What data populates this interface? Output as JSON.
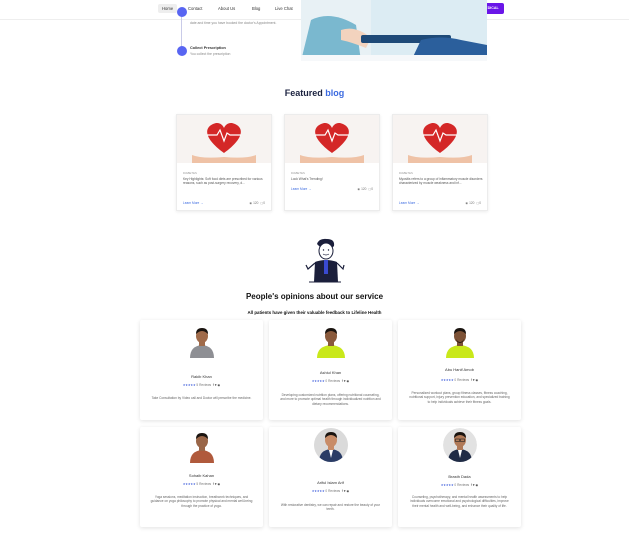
{
  "nav": {
    "items": [
      "Home",
      "Contact",
      "About Us",
      "Blog",
      "Live Chat",
      "Health Calculator",
      "Health Plans",
      "For Doctors",
      "Services"
    ],
    "cta": "EMR/MEDICAL"
  },
  "timeline": {
    "step1_text": "date and time you have booked the doctor's Appointment.",
    "step2_title": "Collect Prescription",
    "step2_text": "You collect the prescription"
  },
  "featured": {
    "title_main": "Featured",
    "title_accent": "blog",
    "posts": [
      {
        "category": "DIABETES",
        "desc": "Key Highlights: Soft food diets are prescribed for various reasons, such as post-surgery recovery, d...",
        "learn": "Learn More",
        "views": "120",
        "comments": "0"
      },
      {
        "category": "DIABETES",
        "desc": "Look What's Trending!",
        "learn": "Learn More",
        "views": "120",
        "comments": "0"
      },
      {
        "category": "DIABETES",
        "desc": "Myositis refers to a group of inflammatory muscle disorders characterized by muscle weakness and inf...",
        "learn": "Learn More",
        "views": "120",
        "comments": "0"
      }
    ]
  },
  "opinions": {
    "title": "People's opinions about our service",
    "subtitle": "All patients have given their valuable feedback to Lifeline Health",
    "reviews": [
      {
        "name": "Rakib Khan",
        "stars": "★★★★★",
        "count": "5 Reviews",
        "social": "f ♥ ◉",
        "text": "Take Consultation by Video call and Doctor will prescribe the medicine."
      },
      {
        "name": "Ashiul Khan",
        "stars": "★★★★★",
        "count": "0 Reviews",
        "social": "f ♥ ◉",
        "text": "Developing customized nutrition plans, offering nutritional counseling, and more to promote optimal health through individualized nutrition and dietary recommendations."
      },
      {
        "name": "Abu Hanif Amob",
        "stars": "★★★★★",
        "count": "0 Reviews",
        "social": "f ♥ ◉",
        "text": "Personalized workout plans, group fitness classes, fitness coaching, nutritional support, injury prevention education, and specialized training to help individuals achieve their fitness goals."
      },
      {
        "name": "Sohaib Kahan",
        "stars": "★★★★★",
        "count": "5 Reviews",
        "social": "f ♥ ◉",
        "text": "Yoga sessions, meditation instruction, breathwork techniques, and guidance on yoga philosophy to promote physical and mental well-being through the practice of yoga."
      },
      {
        "name": "Ariful Islam Arif",
        "stars": "★★★★★",
        "count": "0 Reviews",
        "social": "f ♥ ◉",
        "text": "With restorative dentistry, we can repair and restore the beauty of your teeth."
      },
      {
        "name": "Brasth Dada",
        "stars": "★★★★★",
        "count": "0 Reviews",
        "social": "f ♥ ◉",
        "text": "Counseling, psychotherapy, and mental health assessments to help individuals overcome emotional and psychological difficulties, improve their mental health and well-being, and enhance their quality of life."
      }
    ]
  },
  "colors": {
    "accent": "#3b6ae0",
    "cta": "#6a16e8",
    "timeline_dot": "#5865f2",
    "star": "#3b5bdb"
  }
}
